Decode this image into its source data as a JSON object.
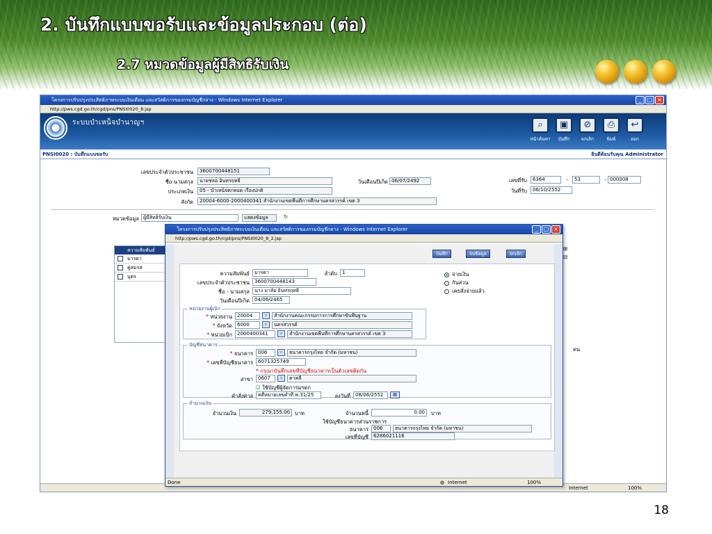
{
  "slide": {
    "title": "2. บันทึกแบบขอรับและข้อมูลประกอบ (ต่อ)",
    "subtitle": "2.7 หมวดข้อมูลผู้มีสิทธิรับเงิน",
    "page_number": "18"
  },
  "browser": {
    "title": "โครงการปรับปรุงประสิทธิภาพระบบเงินเดือน และสวัสดิการของกรมบัญชีกลาง - Windows Internet Explorer",
    "address": "http://pws.cgd.go.th/cgd/pns/PNSI0020_8.jsp"
  },
  "app": {
    "system_name": "ระบบบำเหน็จบำนาญฯ",
    "toolbar": [
      {
        "label": "หน้าค้นหา",
        "icon": "search-doc-icon"
      },
      {
        "label": "บันทึก",
        "icon": "save-icon"
      },
      {
        "label": "ยกเลิก",
        "icon": "cancel-icon"
      },
      {
        "label": "พิมพ์",
        "icon": "print-icon"
      },
      {
        "label": "ออก",
        "icon": "exit-icon"
      }
    ]
  },
  "form": {
    "code_title": "PNSI0020 : บันทึกแบบขอรับ",
    "welcome": "ยินดีต้อนรับคุณ Administrator",
    "id_label": "เลขประจำตัวประชาชน",
    "id_value": "3600700448151",
    "name_label": "ชื่อ-นามสกุล",
    "name_value": "นายชลอ อินทรฤทธิ์",
    "birth_label": "วันเดือนปีเกิด",
    "birth_value": "06/07/2492",
    "paytype_label": "ประเภทเงิน",
    "paytype_value": "05 - บำเหน็จตกทอด  เรื่องปกติ",
    "office_label": "สังกัด",
    "office_value": "20004-6000-2000400341  สำนักงานเขตพื้นที่การศึกษานครสวรรค์ เขต 3",
    "recv_no_label": "เลขที่รับ",
    "recv_no_1": "6364",
    "recv_no_2": "53",
    "recv_no_3": "000008",
    "dash": "-",
    "recv_date_label": "วันที่รับ",
    "recv_date_value": "06/10/2552",
    "category_label": "หมวดข้อมูล",
    "category_value": "ผู้มีสิทธิรับเงิน",
    "show_button": "แสดงข้อมูล",
    "grid_header": "ความสัมพันธ์",
    "grid_rows": [
      "มารดา",
      "คู่สมรส",
      "บุตร"
    ],
    "unit_person": "คน"
  },
  "popup": {
    "title": "โครงการปรับปรุงประสิทธิภาพระบบเงินเดือน และสวัสดิการของกรมบัญชีกลาง - Windows Internet Explorer",
    "address": "http://pws.cgd.go.th/cgd/pns/PNSI0020_8_2.jsp",
    "btn_save": "บันทึก",
    "btn_delete": "ลบข้อมูล",
    "btn_cancel": "ยกเลิก",
    "relation_label": "ความสัมพันธ์",
    "relation_value": "มารดา",
    "order_label": "ลำดับ",
    "order_value": "1",
    "pid_label": "เลขประจำตัวประชาชน",
    "pid_value": "3600700448143",
    "pname_label": "ชื่อ - นามสกุล",
    "pname_value": "นาง มาลัย อินทรฤทธิ์",
    "pbirth_label": "วันเดือนปีเกิด",
    "pbirth_value": "04/06/2465",
    "radios": [
      "จ่ายเงิน",
      "กันส่วน",
      "เคยสั่งจ่ายแล้ว"
    ],
    "unit_legend": "หน่วยงานผู้เบิก",
    "agency_label": "หน่วยงาน",
    "agency_code": "20004",
    "agency_name": "สำนักงานคณะกรรมการการศึกษาขั้นพื้นฐาน",
    "province_label": "จังหวัด",
    "province_code": "6000",
    "province_name": "นครสวรรค์",
    "disb_label": "หน่วยเบิก",
    "disb_code": "2000400341",
    "disb_name": "สำนักงานเขตพื้นที่การศึกษานครสวรรค์ เขต 3",
    "bank_legend": "บัญชีธนาคาร",
    "bank_label": "ธนาคาร",
    "bank_code": "006",
    "bank_name": "ธนาคารกรุงไทย จำกัด (มหาชน)",
    "acct_label": "เลขที่บัญชีธนาคาร",
    "acct_value": "6071325749",
    "note": "* กรุณาบันทึกเลขที่บัญชีธนาคารเป็นตัวเลขติดกัน",
    "branch_label": "สาขา",
    "branch_code": "0607",
    "branch_name": "ตาคลี",
    "heir_check": "ใช้บัญชีผู้จัดการมรดก",
    "court_label": "คำสั่งศาล",
    "court_value": "คดีหมายเลขดำที่ พ.31/25",
    "date_label": "ลงวันที่",
    "date_value": "08/06/2552",
    "money_legend": "จำนวนเงิน",
    "amount_label": "จำนวนเงิน",
    "amount_value": "279,155.00",
    "baht": "บาท",
    "owe_label": "จำนวนหนี้",
    "owe_value": "0.00",
    "govacct_label": "ใช้บัญชีธนาคารส่วนราชการ",
    "gbank_label": "ธนาคาร",
    "gbank_code": "006",
    "gbank_name": "ธนาคารกรุงไทย จำกัด (มหาชน)",
    "gacct_label": "เลขที่บัญชี",
    "gacct_value": "6286021116",
    "status_done": "Done",
    "status_zone": "Internet",
    "status_zoom": "100%"
  },
  "main_status": {
    "zone": "Internet",
    "zoom": "100%"
  }
}
